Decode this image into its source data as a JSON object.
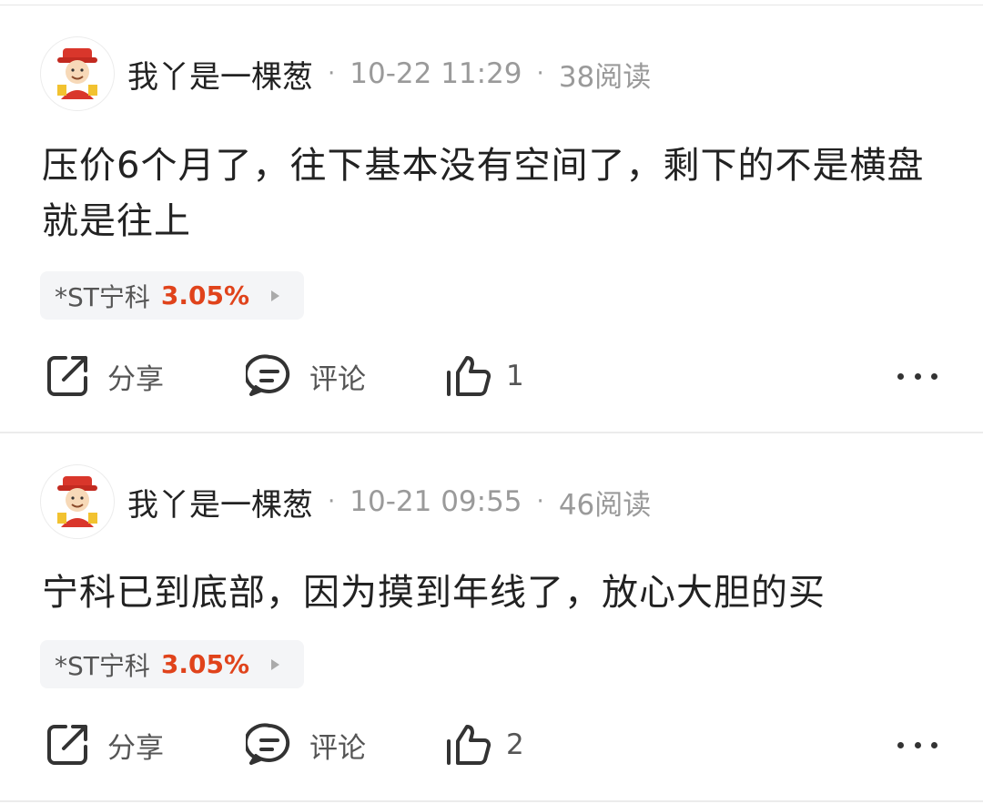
{
  "posts": [
    {
      "username": "我丫是一棵葱",
      "separator": "·",
      "time": "10-22 11:29",
      "reads": "38阅读",
      "content": "压价6个月了，往下基本没有空间了，剩下的不是横盘就是往上",
      "stock": {
        "name": "*ST宁科",
        "change": "3.05%"
      },
      "actions": {
        "share": "分享",
        "comment": "评论",
        "likes": "1"
      }
    },
    {
      "username": "我丫是一棵葱",
      "separator": "·",
      "time": "10-21 09:55",
      "reads": "46阅读",
      "content": "宁科已到底部，因为摸到年线了，放心大胆的买",
      "stock": {
        "name": "*ST宁科",
        "change": "3.05%"
      },
      "actions": {
        "share": "分享",
        "comment": "评论",
        "likes": "2"
      }
    }
  ],
  "colors": {
    "stock_up": "#e0431b",
    "meta_gray": "#9a9a9a",
    "tag_bg": "#f4f5f7"
  },
  "icons": [
    "share-icon",
    "comment-icon",
    "like-icon",
    "more-icon",
    "avatar-caishen"
  ]
}
